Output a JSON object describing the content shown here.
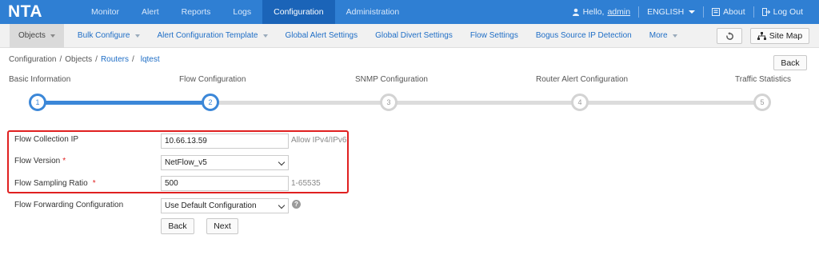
{
  "app": {
    "logo": "NTA",
    "nav": [
      {
        "label": "Monitor"
      },
      {
        "label": "Alert"
      },
      {
        "label": "Reports"
      },
      {
        "label": "Logs"
      },
      {
        "label": "Configuration"
      },
      {
        "label": "Administration"
      }
    ],
    "active_nav": "Configuration",
    "user": {
      "greeting": "Hello,",
      "name": "admin",
      "icon": "user-icon"
    },
    "language": "ENGLISH",
    "about": {
      "label": "About",
      "icon": "about-icon"
    },
    "logout": {
      "label": "Log Out",
      "icon": "logout-icon"
    }
  },
  "subnav": {
    "items": [
      {
        "label": "Objects",
        "dropdown": true
      },
      {
        "label": "Bulk Configure",
        "dropdown": true
      },
      {
        "label": "Alert Configuration Template",
        "dropdown": true
      },
      {
        "label": "Global Alert Settings",
        "dropdown": false
      },
      {
        "label": "Global Divert Settings",
        "dropdown": false
      },
      {
        "label": "Flow Settings",
        "dropdown": false
      },
      {
        "label": "Bogus Source IP Detection",
        "dropdown": false
      },
      {
        "label": "More",
        "dropdown": true
      }
    ],
    "refresh_icon": "refresh-icon",
    "sitemap": {
      "label": "Site Map",
      "icon": "sitemap-icon"
    }
  },
  "breadcrumb": {
    "items": [
      "Configuration",
      "Objects",
      "Routers",
      "lqtest"
    ],
    "separator": "/"
  },
  "back_top": "Back",
  "steps": [
    {
      "label": "Basic Information",
      "num": "1",
      "active": true
    },
    {
      "label": "Flow Configuration",
      "num": "2",
      "active": true
    },
    {
      "label": "SNMP Configuration",
      "num": "3",
      "active": false
    },
    {
      "label": "Router Alert Configuration",
      "num": "4",
      "active": false
    },
    {
      "label": "Traffic Statistics",
      "num": "5",
      "active": false
    }
  ],
  "form": {
    "collection_ip": {
      "label": "Flow Collection IP",
      "value": "10.66.13.59",
      "hint": "Allow IPv4/IPv6"
    },
    "version": {
      "label": "Flow Version",
      "required": "*",
      "value": "NetFlow_v5"
    },
    "sampling": {
      "label": "Flow Sampling Ratio",
      "required": "*",
      "value": "500",
      "hint": "1-65535"
    },
    "forwarding": {
      "label": "Flow Forwarding Configuration",
      "value": "Use Default Configuration",
      "help_icon": "help-icon"
    },
    "back": "Back",
    "next": "Next"
  },
  "colors": {
    "topbar": "#2f7fd3",
    "active_nav": "#1b64b8",
    "accent": "#3b87d8",
    "highlight_box": "#e02020"
  }
}
